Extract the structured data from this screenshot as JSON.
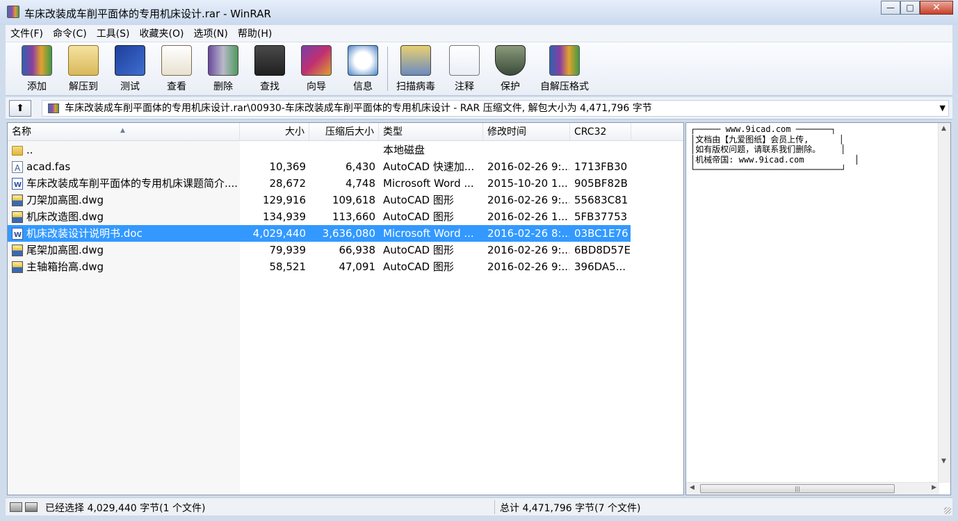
{
  "window": {
    "title": "车床改装成车削平面体的专用机床设计.rar - WinRAR",
    "minimize_glyph": "—",
    "maximize_glyph": "□",
    "close_glyph": "✕"
  },
  "menu": [
    "文件(F)",
    "命令(C)",
    "工具(S)",
    "收藏夹(O)",
    "选项(N)",
    "帮助(H)"
  ],
  "toolbar": [
    {
      "label": "添加",
      "icon": "add-icon"
    },
    {
      "label": "解压到",
      "icon": "extract-to-icon"
    },
    {
      "label": "测试",
      "icon": "test-icon"
    },
    {
      "label": "查看",
      "icon": "view-icon"
    },
    {
      "label": "删除",
      "icon": "delete-icon"
    },
    {
      "label": "查找",
      "icon": "find-icon"
    },
    {
      "label": "向导",
      "icon": "wizard-icon"
    },
    {
      "label": "信息",
      "icon": "info-icon"
    },
    {
      "label": "扫描病毒",
      "icon": "virus-scan-icon"
    },
    {
      "label": "注释",
      "icon": "comment-icon"
    },
    {
      "label": "保护",
      "icon": "protect-icon"
    },
    {
      "label": "自解压格式",
      "icon": "sfx-icon"
    }
  ],
  "address": {
    "path": "车床改装成车削平面体的专用机床设计.rar\\00930-车床改装成车削平面体的专用机床设计 - RAR 压缩文件, 解包大小为 4,471,796 字节",
    "dropdown_glyph": "▼",
    "up_glyph": "⬆"
  },
  "columns": {
    "name": "名称",
    "size": "大小",
    "packed": "压缩后大小",
    "type": "类型",
    "modified": "修改时间",
    "crc": "CRC32",
    "sort_glyph": "▲"
  },
  "files": [
    {
      "name": "..",
      "size": "",
      "packed": "",
      "type": "本地磁盘",
      "modified": "",
      "crc": "",
      "icon": "folder-up-icon",
      "selected": false
    },
    {
      "name": "acad.fas",
      "size": "10,369",
      "packed": "6,430",
      "type": "AutoCAD 快速加...",
      "modified": "2016-02-26 9:...",
      "crc": "1713FB30",
      "icon": "fas-file-icon",
      "selected": false
    },
    {
      "name": "车床改装成车削平面体的专用机床课题简介....",
      "size": "28,672",
      "packed": "4,748",
      "type": "Microsoft Word ...",
      "modified": "2015-10-20 1...",
      "crc": "905BF82B",
      "icon": "word-doc-icon",
      "selected": false
    },
    {
      "name": "刀架加高图.dwg",
      "size": "129,916",
      "packed": "109,618",
      "type": "AutoCAD 图形",
      "modified": "2016-02-26 9:...",
      "crc": "55683C81",
      "icon": "dwg-file-icon",
      "selected": false
    },
    {
      "name": "机床改造图.dwg",
      "size": "134,939",
      "packed": "113,660",
      "type": "AutoCAD 图形",
      "modified": "2016-02-26 1...",
      "crc": "5FB37753",
      "icon": "dwg-file-icon",
      "selected": false
    },
    {
      "name": "机床改装设计说明书.doc",
      "size": "4,029,440",
      "packed": "3,636,080",
      "type": "Microsoft Word ...",
      "modified": "2016-02-26 8:...",
      "crc": "03BC1E76",
      "icon": "word-doc-icon",
      "selected": true
    },
    {
      "name": "尾架加高图.dwg",
      "size": "79,939",
      "packed": "66,938",
      "type": "AutoCAD 图形",
      "modified": "2016-02-26 9:...",
      "crc": "6BD8D57E",
      "icon": "dwg-file-icon",
      "selected": false
    },
    {
      "name": "主轴箱抬高.dwg",
      "size": "58,521",
      "packed": "47,091",
      "type": "AutoCAD 图形",
      "modified": "2016-02-26 9:...",
      "crc": "396DA5...",
      "icon": "dwg-file-icon",
      "selected": false
    }
  ],
  "comment": {
    "lines": [
      "┌───── www.9icad.com ───────┐",
      "│文档由【九爱图纸】会员上传,      │",
      "│如有版权问题，请联系我们删除。    │",
      "│机械帝国: www.9icad.com          │",
      "└─────────────────────────────┘"
    ],
    "scroll_up": "▲",
    "scroll_down": "▼",
    "scroll_left": "◀",
    "scroll_right": "▶",
    "thumb_grip": "|||"
  },
  "status": {
    "left": "已经选择 4,029,440 字节(1 个文件)",
    "right": "总计 4,471,796 字节(7 个文件)"
  }
}
